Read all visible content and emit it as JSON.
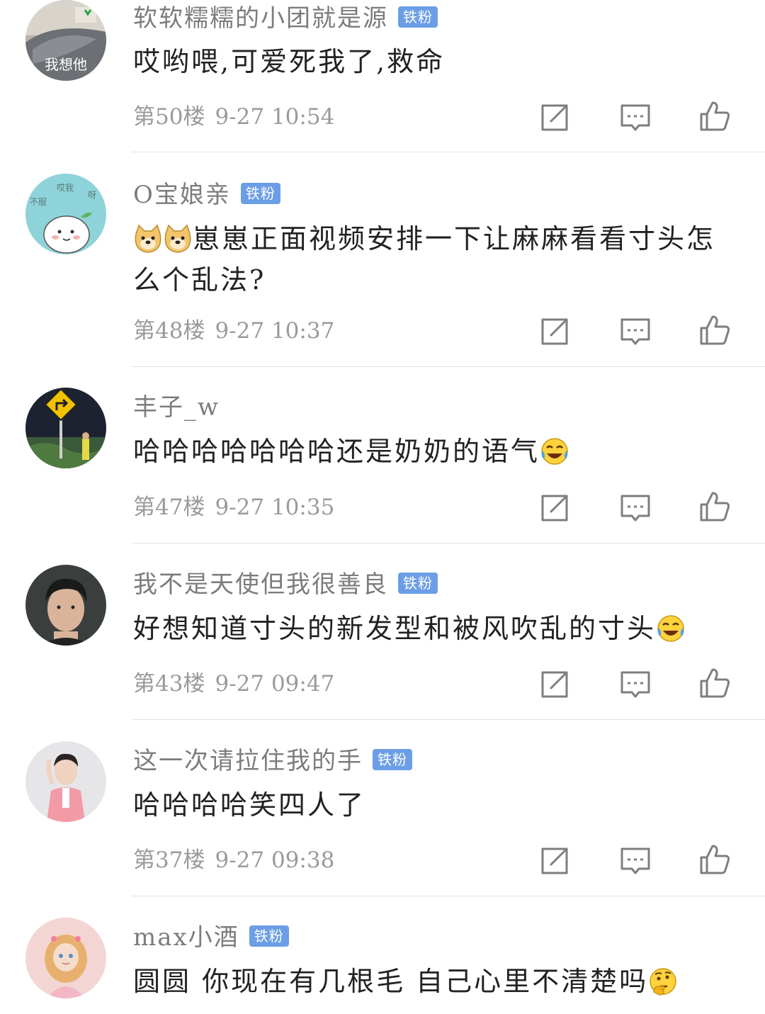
{
  "comments": [
    {
      "username": "软软糯糯的小团就是源",
      "badge": "铁粉",
      "avatar_text": "我想他",
      "text": "哎哟喂,可爱死我了,救命",
      "floor": "第50楼",
      "time": "9-27 10:54"
    },
    {
      "username": "O宝娘亲",
      "badge": "铁粉",
      "avatar_text_1": "哎我",
      "avatar_text_2": "不服",
      "avatar_text_3": "呀",
      "text": "崽崽正面视频安排一下让麻麻看看寸头怎么个乱法?",
      "floor": "第48楼",
      "time": "9-27 10:37"
    },
    {
      "username": "丰子_w",
      "text": "哈哈哈哈哈哈哈还是奶奶的语气",
      "floor": "第47楼",
      "time": "9-27 10:35"
    },
    {
      "username": "我不是天使但我很善良",
      "badge": "铁粉",
      "text": "好想知道寸头的新发型和被风吹乱的寸头",
      "floor": "第43楼",
      "time": "9-27 09:47"
    },
    {
      "username": "这一次请拉住我的手",
      "badge": "铁粉",
      "text": "哈哈哈哈笑四人了",
      "floor": "第37楼",
      "time": "9-27 09:38"
    },
    {
      "username": "max小酒",
      "badge": "铁粉",
      "text": "圆圆 你现在有几根毛 自己心里不清楚吗"
    }
  ],
  "icons": {
    "share": "share-icon",
    "reply": "comment-icon",
    "like": "thumbs-up-icon",
    "emoji_doge": "doge-emoji-icon",
    "emoji_laugh_cry": "laugh-cry-emoji-icon",
    "emoji_thinking": "thinking-emoji-icon"
  },
  "colors": {
    "badge": "#6b9ee6",
    "username": "#7c7c7c",
    "text": "#222222",
    "meta": "#9a9a9a",
    "divider": "#e3e3e3"
  }
}
